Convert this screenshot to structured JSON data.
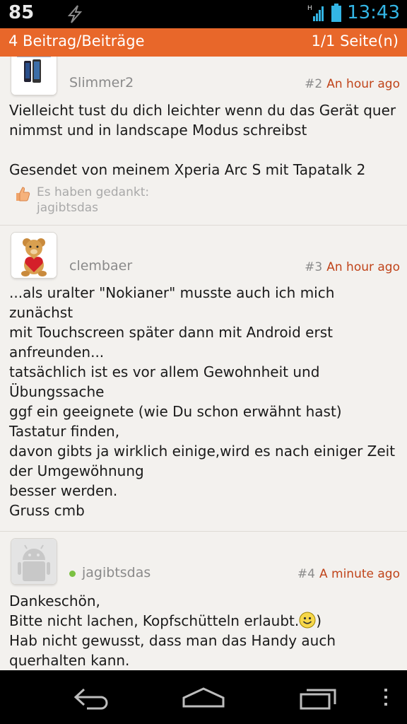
{
  "status_bar": {
    "left_number": "85",
    "time": "13:43",
    "network": "H"
  },
  "header": {
    "post_count": "4 Beitrag/Beiträge",
    "page_info": "1/1 Seite(n)"
  },
  "posts": [
    {
      "username": "Slimmer2",
      "number": "#2",
      "time": "An hour ago",
      "lines": [
        "Vielleicht tust du dich leichter wenn du das Gerät quer",
        "nimmst und in landscape Modus schreibst",
        "",
        "Gesendet von meinem Xperia Arc S mit Tapatalk 2"
      ],
      "thanks_label": "Es haben gedankt:",
      "thanks_user": "jagibtsdas"
    },
    {
      "username": "clembaer",
      "number": "#3",
      "time": "An hour ago",
      "lines": [
        "...als uralter \"Nokianer\" musste auch ich mich",
        "zunächst",
        "mit Touchscreen später dann mit Android erst",
        "anfreunden...",
        "tatsächlich ist es vor allem Gewohnheit und",
        "Übungssache",
        "ggf ein geeignete (wie Du schon erwähnt hast)",
        "Tastatur finden,",
        "davon gibts ja wirklich einige,wird es nach einiger Zeit",
        "der Umgewöhnung",
        "besser werden.",
        "Gruss cmb"
      ]
    },
    {
      "username": "jagibtsdas",
      "number": "#4",
      "time": "A minute ago",
      "lines": [
        "Dankeschön,",
        "Bitte nicht lachen, Kopfschütteln erlaubt.",
        "Hab nicht gewusst, dass man das Handy auch",
        "querhalten kann."
      ],
      "line2_suffix": ")"
    }
  ],
  "colors": {
    "header_bg": "#e8672a",
    "time_color": "#c0441a",
    "status_time": "#33b5e5",
    "online": "#7bc142"
  },
  "icons": {
    "thanks": "thumbs-up-icon",
    "smiley": "smiley-icon",
    "back": "back-icon",
    "home": "home-icon",
    "recents": "recents-icon",
    "menu": "overflow-menu-icon"
  }
}
